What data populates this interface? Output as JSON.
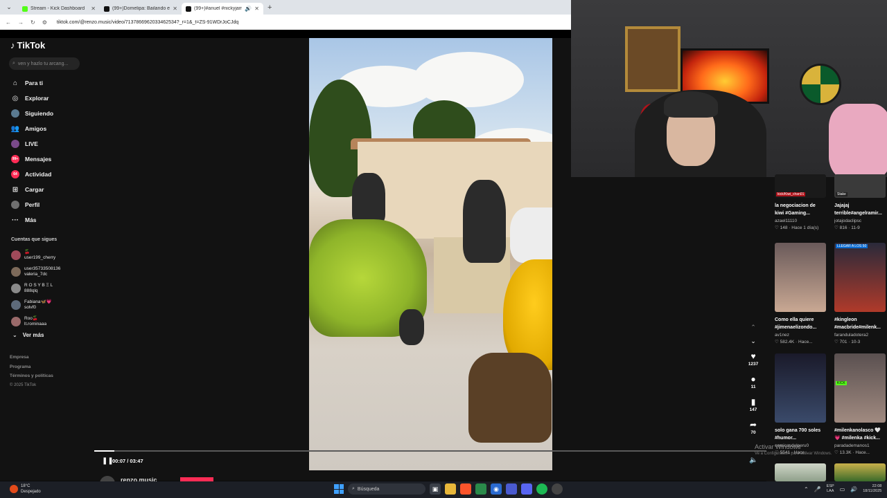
{
  "browser": {
    "tabs": [
      {
        "title": "Stream - Kick Dashboard",
        "favicon": "kick-icon",
        "active": false
      },
      {
        "title": "(99+)Domelipa: Bailando en el",
        "favicon": "tiktok-icon",
        "active": false
      },
      {
        "title": "(99+)#anuel #nickyjam #ar",
        "favicon": "tiktok-icon",
        "active": true
      }
    ],
    "url": "tiktok.com/@renzo.music/video/7137866962033462534?_r=1&_t=ZS-91WDrJoCJdq"
  },
  "sidebar": {
    "logo": "TikTok",
    "search_placeholder": "ven y hazlo tu arcang...",
    "nav": [
      {
        "label": "Para ti",
        "icon": "home-icon"
      },
      {
        "label": "Explorar",
        "icon": "compass-icon"
      },
      {
        "label": "Siguiendo",
        "icon": "avatar-icon"
      },
      {
        "label": "Amigos",
        "icon": "friends-icon"
      },
      {
        "label": "LIVE",
        "icon": "live-icon"
      },
      {
        "label": "Mensajes",
        "icon": "messages-icon",
        "badge": "99+"
      },
      {
        "label": "Actividad",
        "icon": "activity-icon",
        "badge": "64"
      },
      {
        "label": "Cargar",
        "icon": "upload-icon"
      },
      {
        "label": "Perfil",
        "icon": "profile-icon"
      },
      {
        "label": "Más",
        "icon": "more-icon"
      }
    ],
    "following_heading": "Cuentas que sigues",
    "following": [
      {
        "line1": "🍒",
        "line2": "user199_cherry"
      },
      {
        "line1": "user35733508136",
        "line2": "valeria_7dc"
      },
      {
        "line1": "R O S Y B Ξ L",
        "line2": "888qlq"
      },
      {
        "line1": "Fabiana🦋💗",
        "line2": "solvf0"
      },
      {
        "line1": "Roo🍒",
        "line2": "lt.rominaaa"
      }
    ],
    "see_more": "Ver más",
    "footer": [
      "Empresa",
      "Programa",
      "Términos y políticas"
    ],
    "copyright": "© 2025 TikTok"
  },
  "video": {
    "time": "00:07 / 03:47",
    "progress": 0.03,
    "author": "renzo.music"
  },
  "actions": [
    {
      "icon": "heart-icon",
      "count": "1237"
    },
    {
      "icon": "comment-icon",
      "count": "11"
    },
    {
      "icon": "bookmark-icon",
      "count": "147"
    },
    {
      "icon": "share-icon",
      "count": "70"
    }
  ],
  "recommendations": [
    {
      "title": "la negociacion de",
      "title2": "kiwi #Gaming...",
      "author": "azael11110",
      "stats": "♡ 148 · Hace 1 día(s)",
      "tag": "kick/Kiwi_chan01"
    },
    {
      "title": "Jajajaj",
      "title2": "terrible#angelramir...",
      "author": "jotajodaclipsc",
      "stats": "♡ 816 · 11-9",
      "tag": "Stake"
    },
    {
      "title": "Como ella quiere",
      "title2": "#jimenaelizondo...",
      "author": "av1nez",
      "stats": "♡ 582.4K · Hace...",
      "tag": ""
    },
    {
      "title": "#kingleon",
      "title2": "#macbride#milenk...",
      "author": "faranduladotera2",
      "stats": "♡ 701 · 10-3",
      "tag": "LLEGAR A LOS 50"
    },
    {
      "title": "solo gana 700 soles",
      "title2": "#humor...",
      "author": "comicosdelperu0",
      "stats": "♡ 5541 · Hace...",
      "tag": ""
    },
    {
      "title": "#milenkanolasco 🤍",
      "title2": "💗 #milenka #kick...",
      "author": "paradademanos1",
      "stats": "♡ 13.3K · Hace...",
      "tag": "KICK"
    }
  ],
  "watermark": {
    "line1": "Activar Windows",
    "line2": "Ve a Configuración para activar Windows."
  },
  "taskbar": {
    "weather_temp": "18°C",
    "weather_desc": "Despejado",
    "search": "Búsqueda",
    "lang1": "ESP",
    "lang2": "LAA",
    "time": "22:08",
    "date": "18/11/2025"
  },
  "colors": {
    "accent": "#fe2c55",
    "kick_green": "#53fc18",
    "background": "#121212"
  }
}
